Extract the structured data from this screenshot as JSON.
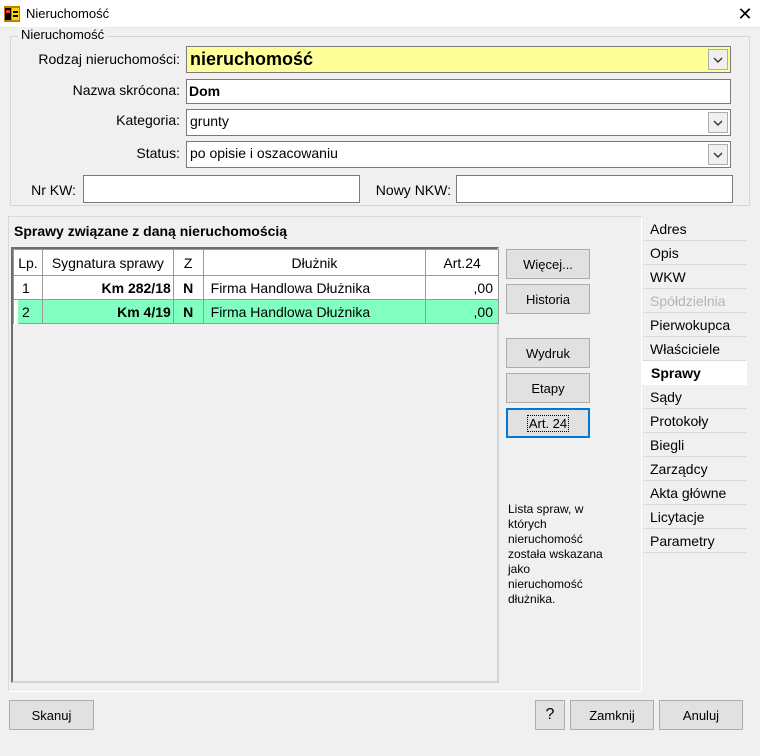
{
  "window": {
    "title": "Nieruchomość",
    "close_glyph": "✕",
    "icon": "app-icon"
  },
  "group": {
    "legend": "Nieruchomość"
  },
  "form": {
    "type_label": "Rodzaj nieruchomości:",
    "type_value": "nieruchomość",
    "short_name_label": "Nazwa skrócona:",
    "short_name_value": "Dom",
    "category_label": "Kategoria:",
    "category_value": "grunty",
    "status_label": "Status:",
    "status_value": "po opisie i oszacowaniu",
    "kw_label": "Nr KW:",
    "kw_value": "",
    "nkw_label": "Nowy NKW:",
    "nkw_value": "",
    "highlight_color": "#ffff99"
  },
  "cases": {
    "title": "Sprawy związane z daną nieruchomością",
    "columns": [
      "Lp.",
      "Sygnatura sprawy",
      "Z",
      "Dłużnik",
      "Art.24"
    ],
    "rows": [
      {
        "lp": "1",
        "signature": "Km 282/18",
        "z": "N",
        "debtor": "Firma Handlowa Dłużnika",
        "art24": ",00"
      },
      {
        "lp": "2",
        "signature": "Km 4/19",
        "z": "N",
        "debtor": "Firma Handlowa Dłużnika",
        "art24": ",00"
      }
    ],
    "selected_row_color": "#80ffc0",
    "buttons": {
      "more": "Więcej...",
      "history": "Historia",
      "print": "Wydruk",
      "stages": "Etapy",
      "art24": "Art. 24"
    },
    "hint": "Lista spraw, w których nieruchomość została wskazana jako nieruchomość dłużnika."
  },
  "tabs": [
    {
      "label": "Adres",
      "state": "normal"
    },
    {
      "label": "Opis",
      "state": "normal"
    },
    {
      "label": "WKW",
      "state": "normal"
    },
    {
      "label": "Spółdzielnia",
      "state": "disabled"
    },
    {
      "label": "Pierwokupca",
      "state": "normal"
    },
    {
      "label": "Właściciele",
      "state": "normal"
    },
    {
      "label": "Sprawy",
      "state": "active"
    },
    {
      "label": "Sądy",
      "state": "normal"
    },
    {
      "label": "Protokoły",
      "state": "normal"
    },
    {
      "label": "Biegli",
      "state": "normal"
    },
    {
      "label": "Zarządcy",
      "state": "normal"
    },
    {
      "label": "Akta główne",
      "state": "normal"
    },
    {
      "label": "Licytacje",
      "state": "normal"
    },
    {
      "label": "Parametry",
      "state": "normal"
    }
  ],
  "footer": {
    "scan": "Skanuj",
    "help": "?",
    "close": "Zamknij",
    "cancel": "Anuluj"
  }
}
